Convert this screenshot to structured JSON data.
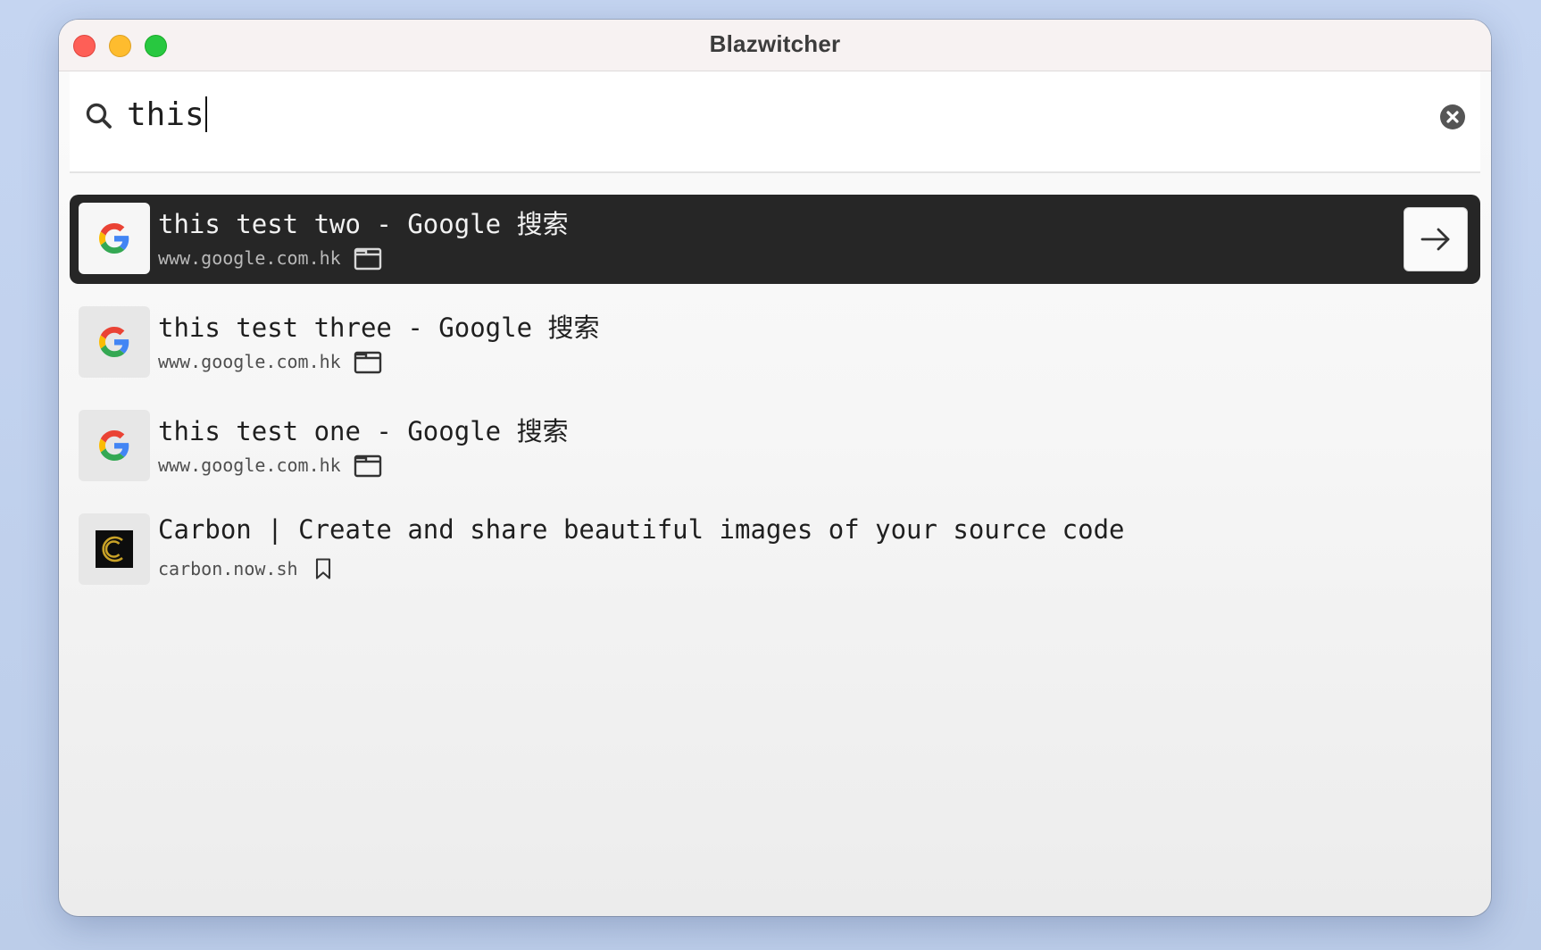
{
  "window": {
    "title": "Blazwitcher"
  },
  "search": {
    "query": "this"
  },
  "results": [
    {
      "title": "this test two - Google 搜索",
      "url": "www.google.com.hk",
      "favicon": "google-icon",
      "type": "tab-icon",
      "selected": true
    },
    {
      "title": "this test three - Google 搜索",
      "url": "www.google.com.hk",
      "favicon": "google-icon",
      "type": "tab-icon",
      "selected": false
    },
    {
      "title": "this test one - Google 搜索",
      "url": "www.google.com.hk",
      "favicon": "google-icon",
      "type": "tab-icon",
      "selected": false
    },
    {
      "title": "Carbon | Create and share beautiful images of your source code",
      "url": "carbon.now.sh",
      "favicon": "carbon-icon",
      "type": "bookmark-icon",
      "selected": false
    }
  ],
  "actions": {
    "open": "arrow-right-icon"
  },
  "colors": {
    "selected_row": "#262626",
    "window_bg": "#f6f6f6"
  }
}
